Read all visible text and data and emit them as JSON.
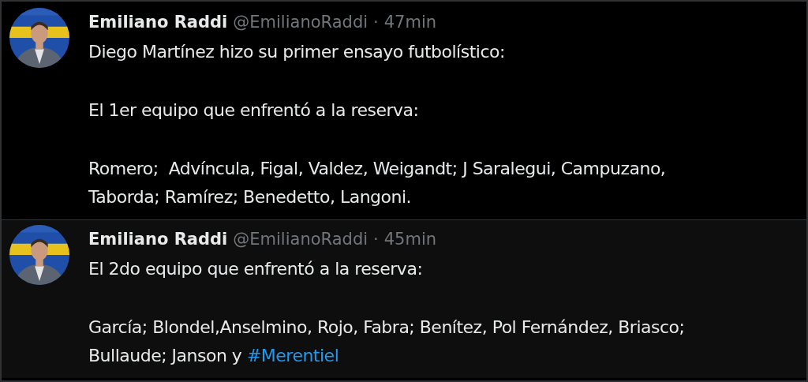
{
  "tweets": [
    {
      "author": "Emiliano Raddi",
      "handle": "@EmilianoRaddi",
      "separator": "·",
      "time": "47min",
      "paragraphs": [
        [
          [
            {
              "kind": "text",
              "text": "Diego Martínez hizo su primer ensayo futbolístico:"
            }
          ]
        ],
        [
          [
            {
              "kind": "text",
              "text": "El 1er equipo que enfrentó a la reserva:"
            }
          ]
        ],
        [
          [
            {
              "kind": "text",
              "text": "Romero;  Advíncula, Figal, Valdez, Weigandt; J Saralegui, Campuzano,"
            }
          ],
          [
            {
              "kind": "text",
              "text": "Taborda; Ramírez; Benedetto, Langoni."
            }
          ]
        ]
      ]
    },
    {
      "author": "Emiliano Raddi",
      "handle": "@EmilianoRaddi",
      "separator": "·",
      "time": "45min",
      "paragraphs": [
        [
          [
            {
              "kind": "text",
              "text": "El 2do equipo que enfrentó a la reserva:"
            }
          ]
        ],
        [
          [
            {
              "kind": "text",
              "text": "García; Blondel,Anselmino, Rojo, Fabra; Benítez, Pol Fernández, Briasco;"
            }
          ],
          [
            {
              "kind": "text",
              "text": "Bullaude; Janson y "
            },
            {
              "kind": "hashtag",
              "text": "#Merentiel"
            }
          ]
        ]
      ]
    }
  ]
}
